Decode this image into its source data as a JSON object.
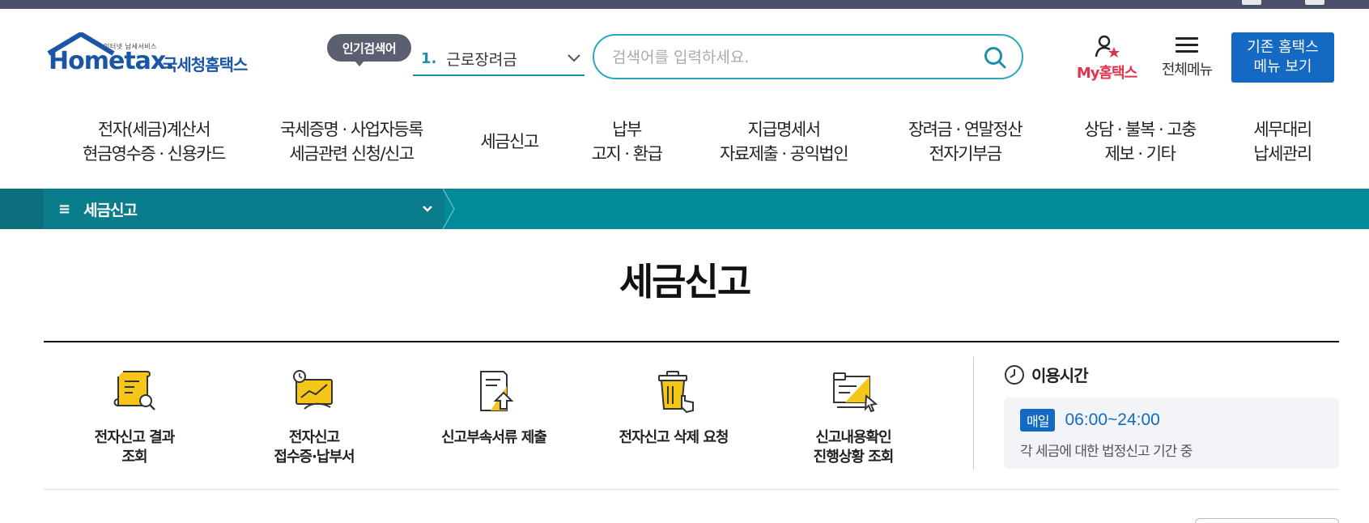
{
  "header": {
    "logo_tagline": "인터넷 납세서비스",
    "logo_brand": "Hometax.",
    "logo_name": "국세청홈택스",
    "popular_badge": "인기검색어",
    "popular_rank": "1.",
    "popular_term": "근로장려금",
    "search_placeholder": "검색어를 입력하세요.",
    "my_label": "My홈택스",
    "allmenu_label": "전체메뉴",
    "oldmenu_line1": "기존 홈택스",
    "oldmenu_line2": "메뉴 보기"
  },
  "gnb": [
    {
      "line1": "전자(세금)계산서",
      "line2": "현금영수증 · 신용카드"
    },
    {
      "line1": "국세증명 · 사업자등록",
      "line2": "세금관련 신청/신고"
    },
    {
      "line1": "세금신고",
      "line2": ""
    },
    {
      "line1": "납부",
      "line2": "고지 · 환급"
    },
    {
      "line1": "지급명세서",
      "line2": "자료제출 · 공익법인"
    },
    {
      "line1": "장려금 · 연말정산",
      "line2": "전자기부금"
    },
    {
      "line1": "상담 · 불복 · 고충",
      "line2": "제보 · 기타"
    },
    {
      "line1": "세무대리",
      "line2": "납세관리"
    }
  ],
  "location": {
    "current": "세금신고"
  },
  "page_title": "세금신고",
  "quick_menu": [
    {
      "line1": "전자신고 결과",
      "line2": "조회",
      "icon": "document-search-icon"
    },
    {
      "line1": "전자신고",
      "line2": "접수증·납부서",
      "icon": "receipt-chart-icon"
    },
    {
      "line1": "신고부속서류 제출",
      "line2": "",
      "icon": "document-upload-icon"
    },
    {
      "line1": "전자신고 삭제 요청",
      "line2": "",
      "icon": "trash-delete-icon"
    },
    {
      "line1": "신고내용확인",
      "line2": "진행상황 조회",
      "icon": "status-check-icon"
    }
  ],
  "usage": {
    "title": "이용시간",
    "badge": "매일",
    "time": "06:00~24:00",
    "desc": "각 세금에 대한 법정신고 기간 중"
  },
  "colors": {
    "accent_teal": "#008b9a",
    "brand_blue": "#1469c2",
    "my_red": "#e0344c",
    "icon_yellow": "#f5c518"
  }
}
